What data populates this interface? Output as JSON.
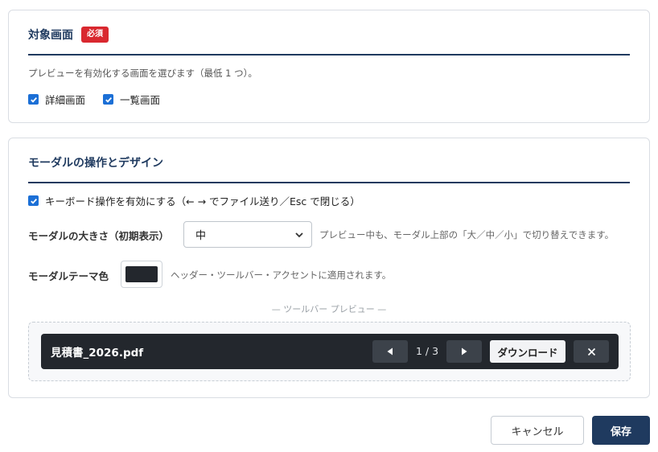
{
  "section_target": {
    "title": "対象画面",
    "required_badge": "必須",
    "description": "プレビューを有効化する画面を選びます（最低 1 つ）。",
    "options": [
      {
        "label": "詳細画面",
        "checked": true
      },
      {
        "label": "一覧画面",
        "checked": true
      }
    ]
  },
  "section_modal": {
    "title": "モーダルの操作とデザイン",
    "keyboard_option": {
      "label": "キーボード操作を有効にする（← → でファイル送り／Esc で閉じる）",
      "checked": true
    },
    "size_label": "モーダルの大きさ（初期表示）",
    "size_value": "中",
    "size_hint": "プレビュー中も、モーダル上部の「大／中／小」で切り替えできます。",
    "theme_label": "モーダルテーマ色",
    "theme_color": "#23272d",
    "theme_hint": "ヘッダー・ツールバー・アクセントに適用されます。",
    "preview_caption": "— ツールバー プレビュー —",
    "toolbar": {
      "file_name": "見積書_2026.pdf",
      "page": "1 / 3",
      "download_label": "ダウンロード",
      "prev_icon": "triangle-left-icon",
      "next_icon": "triangle-right-icon",
      "close_icon": "close-icon"
    }
  },
  "actions": {
    "cancel_label": "キャンセル",
    "save_label": "保存"
  },
  "colors": {
    "accent": "#1f3a5f",
    "badge": "#d9282f",
    "checkbox": "#1b6fd6",
    "toolbar_bg": "#23272d"
  }
}
